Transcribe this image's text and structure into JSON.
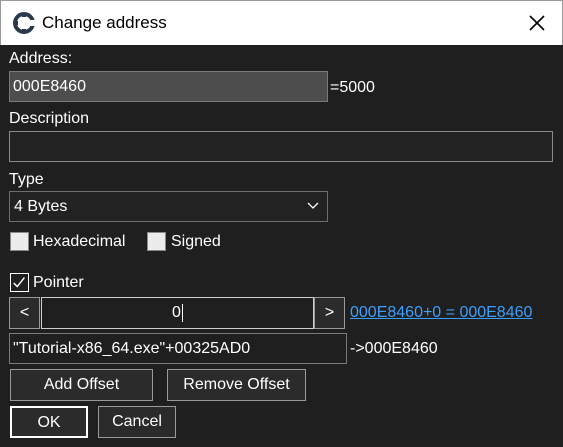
{
  "window": {
    "title": "Change address",
    "icon": "cheat-engine-icon",
    "close_icon": "close-icon"
  },
  "address": {
    "label": "Address:",
    "value": "000E8460",
    "result": "=5000"
  },
  "description": {
    "label": "Description",
    "value": ""
  },
  "type": {
    "label": "Type",
    "selected": "4 Bytes"
  },
  "options": {
    "hexadecimal": {
      "label": "Hexadecimal",
      "checked": false
    },
    "signed": {
      "label": "Signed",
      "checked": false
    }
  },
  "pointer": {
    "label": "Pointer",
    "checked": true,
    "dec_label": "<",
    "inc_label": ">",
    "offset_value": "0",
    "offset_link": "000E8460+0 = 000E8460",
    "base_value": "\"Tutorial-x86_64.exe\"+00325AD0",
    "base_result": "->000E8460"
  },
  "buttons": {
    "add_offset": "Add Offset",
    "remove_offset": "Remove Offset",
    "ok": "OK",
    "cancel": "Cancel"
  }
}
